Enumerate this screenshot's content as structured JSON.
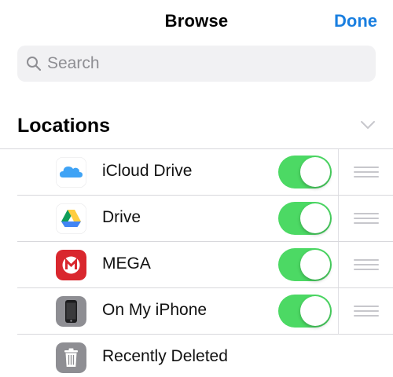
{
  "navbar": {
    "title": "Browse",
    "done_label": "Done"
  },
  "search": {
    "placeholder": "Search"
  },
  "locations": {
    "title": "Locations",
    "items": [
      {
        "label": "iCloud Drive",
        "icon": "icloud-drive-icon",
        "toggle_on": true
      },
      {
        "label": "Drive",
        "icon": "google-drive-icon",
        "toggle_on": true
      },
      {
        "label": "MEGA",
        "icon": "mega-icon",
        "toggle_on": true
      },
      {
        "label": "On My iPhone",
        "icon": "iphone-icon",
        "toggle_on": true
      },
      {
        "label": "Recently Deleted",
        "icon": "trash-icon"
      }
    ]
  },
  "colors": {
    "accent": "#1a7fe0",
    "toggle_on": "#4cd964",
    "mega_red": "#d9272e"
  }
}
